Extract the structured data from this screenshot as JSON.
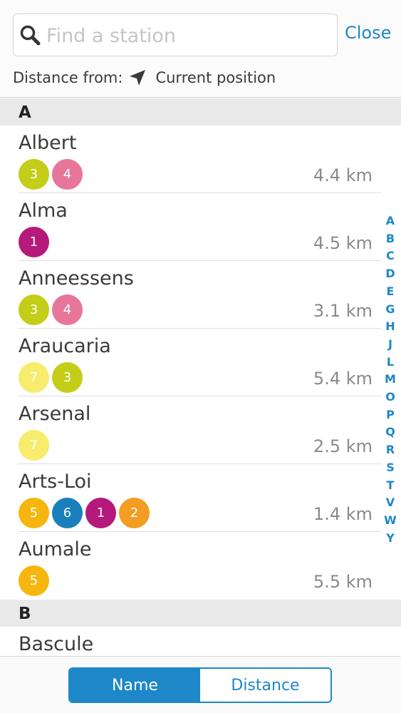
{
  "search": {
    "placeholder": "Find a station",
    "value": ""
  },
  "header": {
    "close_label": "Close",
    "distance_label": "Distance from:",
    "position_label": "Current position"
  },
  "line_colors": {
    "1": "#b5197a",
    "2": "#f39d22",
    "3": "#c4cd17",
    "4": "#e8769a",
    "5": "#f6b60f",
    "6": "#1a80bd",
    "7": "#f7ec6c"
  },
  "sections": [
    {
      "letter": "A",
      "stations": [
        {
          "name": "Albert",
          "lines": [
            "3",
            "4"
          ],
          "distance": "4.4 km"
        },
        {
          "name": "Alma",
          "lines": [
            "1"
          ],
          "distance": "4.5 km"
        },
        {
          "name": "Anneessens",
          "lines": [
            "3",
            "4"
          ],
          "distance": "3.1 km"
        },
        {
          "name": "Araucaria",
          "lines": [
            "7",
            "3"
          ],
          "distance": "5.4 km"
        },
        {
          "name": "Arsenal",
          "lines": [
            "7"
          ],
          "distance": "2.5 km"
        },
        {
          "name": "Arts-Loi",
          "lines": [
            "5",
            "6",
            "1",
            "2"
          ],
          "distance": "1.4 km"
        },
        {
          "name": "Aumale",
          "lines": [
            "5"
          ],
          "distance": "5.5 km"
        }
      ]
    },
    {
      "letter": "B",
      "stations": [
        {
          "name": "Bascule",
          "lines": [],
          "distance": ""
        }
      ]
    }
  ],
  "alpha_index": [
    "A",
    "B",
    "C",
    "D",
    "E",
    "G",
    "H",
    "J",
    "L",
    "M",
    "O",
    "P",
    "Q",
    "R",
    "S",
    "T",
    "V",
    "W",
    "Y"
  ],
  "footer": {
    "sort_name_label": "Name",
    "sort_distance_label": "Distance",
    "active": "Name"
  }
}
